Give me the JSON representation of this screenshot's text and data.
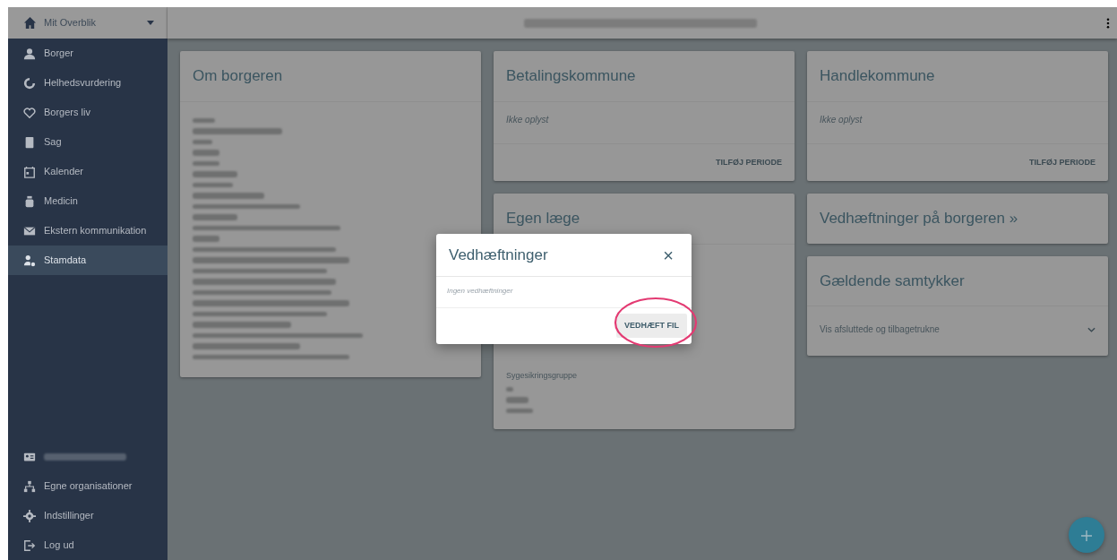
{
  "top_menu": {
    "label": "Mit Overblik"
  },
  "sidebar": {
    "items": [
      {
        "label": "Borger",
        "selected": false
      },
      {
        "label": "Helhedsvurdering",
        "selected": false
      },
      {
        "label": "Borgers liv",
        "selected": false
      },
      {
        "label": "Sag",
        "selected": false
      },
      {
        "label": "Kalender",
        "selected": false
      },
      {
        "label": "Medicin",
        "selected": false
      },
      {
        "label": "Ekstern kommunikation",
        "selected": false
      },
      {
        "label": "Stamdata",
        "selected": true
      }
    ],
    "bottom_items": [
      {
        "kind": "redacted"
      },
      {
        "kind": "link",
        "label": "Egne organisationer"
      },
      {
        "kind": "link",
        "label": "Indstillinger"
      },
      {
        "kind": "link",
        "label": "Log ud"
      }
    ]
  },
  "header": {
    "citizen_redacted": true
  },
  "cards": {
    "om_borgeren": {
      "title": "Om borgeren",
      "redacted": true
    },
    "betalingskommune": {
      "title": "Betalingskommune",
      "value": "Ikke oplyst",
      "action": "TILFØJ PERIODE"
    },
    "handlekommune": {
      "title": "Handlekommune",
      "value": "Ikke oplyst",
      "action": "TILFØJ PERIODE"
    },
    "egen_laege": {
      "title": "Egen læge",
      "label": "Sygesikringsgruppe",
      "redacted": true
    },
    "vedhaeftninger": {
      "title": "Vedhæftninger på borgeren »"
    },
    "samtykker": {
      "title": "Gældende samtykker",
      "toggle": "Vis afsluttede og tilbagetrukne",
      "expanded": false
    }
  },
  "dialog": {
    "title": "Vedhæftninger",
    "close": "×",
    "empty_text": "Ingen vedhæftninger",
    "button": "VEDHÆFT FIL",
    "highlighted": true
  }
}
